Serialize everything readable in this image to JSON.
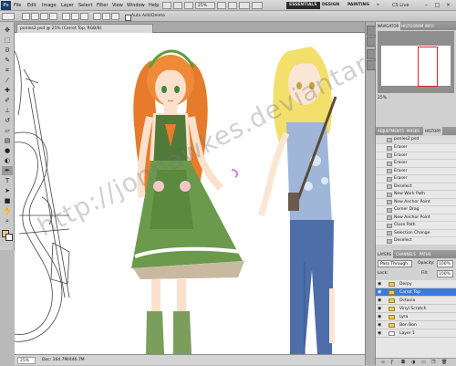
{
  "menubar": {
    "logo": "Ps",
    "menus": [
      "File",
      "Edit",
      "Image",
      "Layer",
      "Select",
      "Filter",
      "View",
      "Window",
      "Help"
    ],
    "zoom": "25%",
    "workspaces": [
      "ESSENTIALS",
      "DESIGN",
      "PAINTING"
    ],
    "more": "»",
    "cs_live": "CS Live",
    "window_controls": [
      "–",
      "□",
      "×"
    ]
  },
  "options": {
    "feather_label": "Feather:",
    "feather_value": "0 px",
    "antialias_label": "Anti-alias",
    "style_label": "Style:",
    "style_value": "Normal",
    "refine_label": "Refine Edge...",
    "auto_add_delete": "Auto Add/Delete"
  },
  "document": {
    "tab_title": "ponies2.psd @ 25% (Carrot Top, RGB/8)",
    "zoom": "25%",
    "doc_info": "Doc: 164.7M/446.7M",
    "watermark": "http://jonnawkes.deviantart.com"
  },
  "navigator": {
    "tabs": [
      "NAVIGATOR",
      "HISTOGRAM",
      "INFO"
    ],
    "zoom": "25%"
  },
  "history": {
    "tabs": [
      "ADJUSTMENTS",
      "MASKS",
      "HISTORY"
    ],
    "snapshot": "ponies2.psd",
    "items": [
      "Eraser",
      "Eraser",
      "Eraser",
      "Eraser",
      "Eraser",
      "Deselect",
      "New Work Path",
      "New Anchor Point",
      "Corner Drag",
      "New Anchor Point",
      "Close Path",
      "Selection Change",
      "Deselect",
      "Delete Layer"
    ]
  },
  "layers": {
    "tabs": [
      "LAYERS",
      "CHANNELS",
      "PATHS"
    ],
    "blend_mode": "Pass Through",
    "opacity_label": "Opacity:",
    "opacity_value": "100%",
    "lock_label": "Lock:",
    "fill_label": "Fill:",
    "fill_value": "100%",
    "items": [
      {
        "name": "Derpy",
        "selected": false,
        "type": "group"
      },
      {
        "name": "Carrot Top",
        "selected": true,
        "type": "group"
      },
      {
        "name": "Octavia",
        "selected": false,
        "type": "group"
      },
      {
        "name": "Vinyl Scratch",
        "selected": false,
        "type": "group"
      },
      {
        "name": "Lyra",
        "selected": false,
        "type": "group"
      },
      {
        "name": "Bon Bon",
        "selected": false,
        "type": "group"
      },
      {
        "name": "Layer 1",
        "selected": false,
        "type": "layer"
      }
    ],
    "footer_icons": [
      "link-icon",
      "fx-icon",
      "mask-icon",
      "adjustment-icon",
      "folder-icon",
      "new-layer-icon",
      "trash-icon"
    ]
  },
  "colors": {
    "selected_layer": "#3f7ad8",
    "workspace_active": "#2b2b2b",
    "foreground": "#f2c58a",
    "background": "#ffffff"
  }
}
